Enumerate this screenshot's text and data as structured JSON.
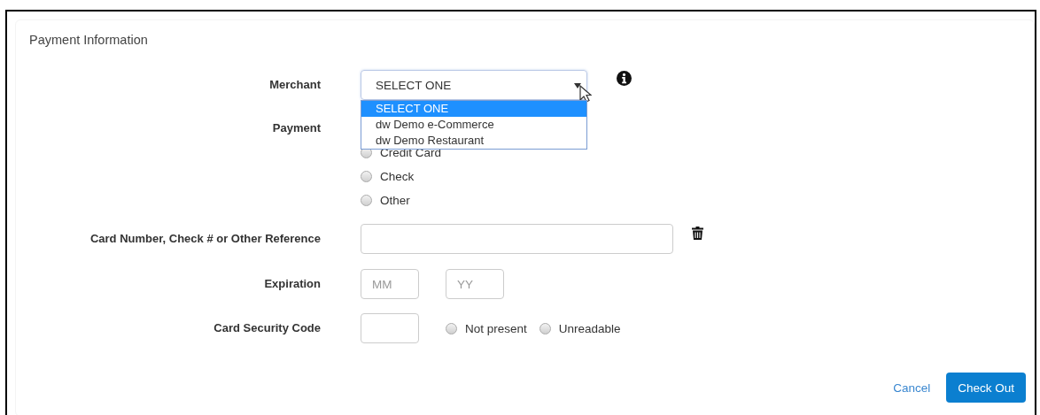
{
  "section": {
    "title": "Payment Information"
  },
  "merchant": {
    "label": "Merchant",
    "value": "SELECT ONE",
    "expanded": true,
    "options": [
      {
        "label": "SELECT ONE",
        "selected": true
      },
      {
        "label": "dw Demo e-Commerce",
        "selected": false
      },
      {
        "label": "dw Demo Restaurant",
        "selected": false
      }
    ]
  },
  "payment": {
    "label": "Payment",
    "options": [
      {
        "label": "Credit Card",
        "selected": false
      },
      {
        "label": "Check",
        "selected": false
      },
      {
        "label": "Other",
        "selected": false
      }
    ]
  },
  "reference": {
    "label": "Card Number, Check # or Other Reference"
  },
  "expiration": {
    "label": "Expiration",
    "month": {
      "placeholder": "MM"
    },
    "year": {
      "placeholder": "YY"
    }
  },
  "security": {
    "label": "Card Security Code",
    "options": [
      {
        "label": "Not present",
        "selected": false
      },
      {
        "label": "Unreadable",
        "selected": false
      }
    ]
  },
  "buttons": [
    {
      "label": "Cancel",
      "kind": "link"
    },
    {
      "label": "Check Out",
      "kind": "primary"
    }
  ]
}
